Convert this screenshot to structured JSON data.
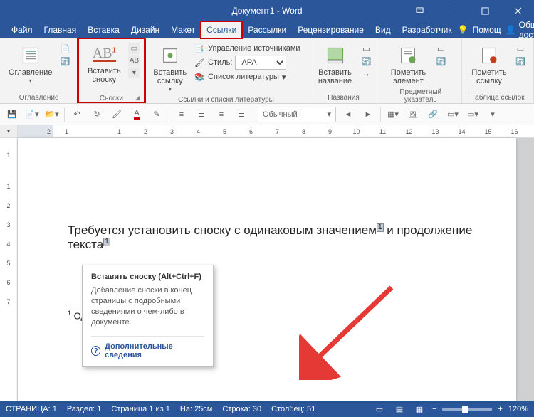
{
  "title": "Документ1 - Word",
  "tabs": {
    "file": "Файл",
    "home": "Главная",
    "insert": "Вставка",
    "design": "Дизайн",
    "layout": "Макет",
    "references": "Ссылки",
    "mailings": "Рассылки",
    "review": "Рецензирование",
    "view": "Вид",
    "developer": "Разработчик"
  },
  "help_label": "Помощ",
  "share_label": "Общий доступ",
  "ribbon": {
    "toc": {
      "label": "Оглавление",
      "group": "Оглавление"
    },
    "footnotes": {
      "insert": "Вставить сноску",
      "group": "Сноски"
    },
    "citations": {
      "insert": "Вставить ссылку",
      "manage": "Управление источниками",
      "style_label": "Стиль:",
      "style_value": "APA",
      "bibliography": "Список литературы",
      "group": "Ссылки и списки литературы"
    },
    "captions": {
      "insert": "Вставить название",
      "group": "Названия"
    },
    "index": {
      "mark": "Пометить элемент",
      "group": "Предметный указатель"
    },
    "authorities": {
      "mark": "Пометить ссылку",
      "group": "Таблица ссылок"
    }
  },
  "qat": {
    "style_value": "Обычный"
  },
  "tooltip": {
    "title": "Вставить сноску (Alt+Ctrl+F)",
    "body": "Добавление сноски в конец страницы с подробными сведениями о чем-либо в документе.",
    "more": "Дополнительные сведения"
  },
  "ruler_h_margin_tick": "2",
  "ruler_h_ticks": [
    "1",
    "",
    "1",
    "2",
    "3",
    "4",
    "5",
    "6",
    "7",
    "8",
    "9",
    "10",
    "11",
    "12",
    "13",
    "14",
    "15",
    "16"
  ],
  "ruler_v_ticks": [
    "",
    "1",
    "",
    "1",
    "2",
    "3",
    "4",
    "5",
    "6",
    "7"
  ],
  "document": {
    "line_part1": "Требуется установить сноску с одинаковым значением",
    "ref1": "1",
    "line_part2": " и продолжение текста",
    "ref2": "1",
    "footnote_num": "1",
    "footnote_text": " Один текст"
  },
  "status": {
    "page_lbl": "СТРАНИЦА:",
    "page": "1",
    "section_lbl": "Раздел:",
    "section": "1",
    "pages": "Страница 1 из 1",
    "pos_lbl": "На:",
    "pos": "25см",
    "line_lbl": "Строка:",
    "line": "30",
    "col_lbl": "Столбец:",
    "col": "51",
    "zoom": "120%"
  },
  "colors": {
    "accent": "#2b579a",
    "highlight": "#c00"
  }
}
